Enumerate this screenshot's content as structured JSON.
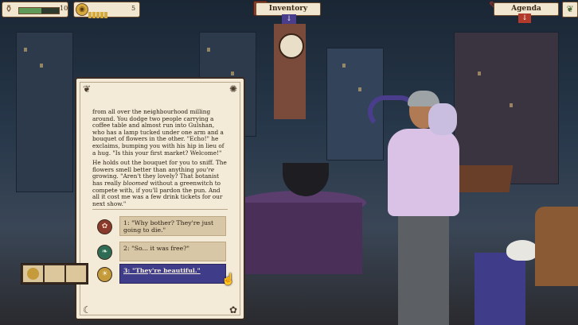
{
  "hud": {
    "stamina_value": "10",
    "stamina_fraction": 0.55,
    "coins_value": "5",
    "coin_slots_filled": 5,
    "inventory_label": "Inventory",
    "agenda_label": "Agenda"
  },
  "dialog": {
    "paragraph1": "from all over the neighbourhood milling around. You dodge two people carrying a coffee table and almost run into Gulshan, who has a lamp tucked under one arm and a bouquet of flowers in the other. \"Echo!\" he exclaims, bumping you with his hip in lieu of a hug. \"Is this your first market? Welcome!\"",
    "paragraph2_a": "He holds out the bouquet for you to sniff. The flowers smell better than anything ",
    "paragraph2_em1": "you're",
    "paragraph2_b": " growing. \"Aren't they lovely? That botanist has really ",
    "paragraph2_em2": "bloomed",
    "paragraph2_c": " without a greenwitch to compete with, if you'll pardon the pun. And all it cost me was a few drink tickets for our next show.\""
  },
  "options": [
    {
      "text": "1: \"Why bother? They're just going to die.\"",
      "icon": "lotus-icon"
    },
    {
      "text": "2: \"So... it was free?\"",
      "icon": "leaf-icon"
    },
    {
      "text": "3: \"They're beautiful.\"",
      "icon": "sun-icon",
      "selected": true
    }
  ],
  "colors": {
    "panel": "#f3ead7",
    "option": "#d8c7a6",
    "option_selected": "#3f3c8a"
  }
}
